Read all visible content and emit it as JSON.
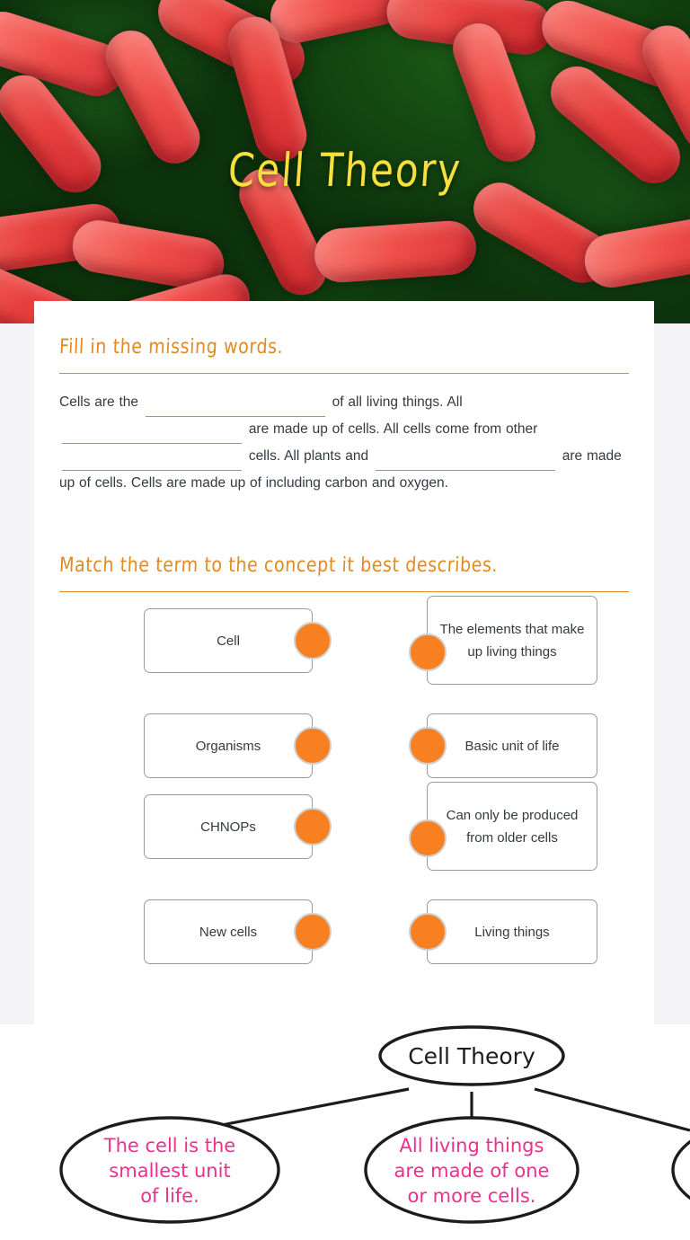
{
  "banner": {
    "title": "Cell Theory",
    "title_color": "#f7e03c",
    "image_description": "red-rod-bacteria-microscopy"
  },
  "accent_color": "#e08a22",
  "dot_color": "#f98020",
  "sections": {
    "fill_in": {
      "heading": "Fill in the missing words.",
      "text_parts": [
        "Cells are the",
        "of all living things. All",
        "are made up of cells. All cells come from other",
        "cells. All plants and",
        "are made up of cells. Cells are made up of",
        "including carbon and oxygen."
      ],
      "blanks": [
        {
          "value": "",
          "placeholder": ""
        },
        {
          "value": "",
          "placeholder": ""
        },
        {
          "value": "",
          "placeholder": ""
        },
        {
          "value": "",
          "placeholder": ""
        }
      ]
    },
    "match": {
      "heading": "Match the term to the concept it best describes.",
      "left_items": [
        {
          "label": "Cell"
        },
        {
          "label": "Organisms"
        },
        {
          "label": "CHNOPs"
        },
        {
          "label": "New cells"
        }
      ],
      "right_items": [
        {
          "label": "The elements that make up living things"
        },
        {
          "label": "Basic unit of life"
        },
        {
          "label": "Can only be produced from older cells"
        },
        {
          "label": "Living things"
        }
      ]
    },
    "diagram": {
      "root": "Cell Theory",
      "branches": [
        "The cell is the smallest unit of life.",
        "All living things are made of one or more cells.",
        ""
      ],
      "root_text_color": "#1c1c1c",
      "branch_text_color": "#ef2f8f"
    }
  }
}
